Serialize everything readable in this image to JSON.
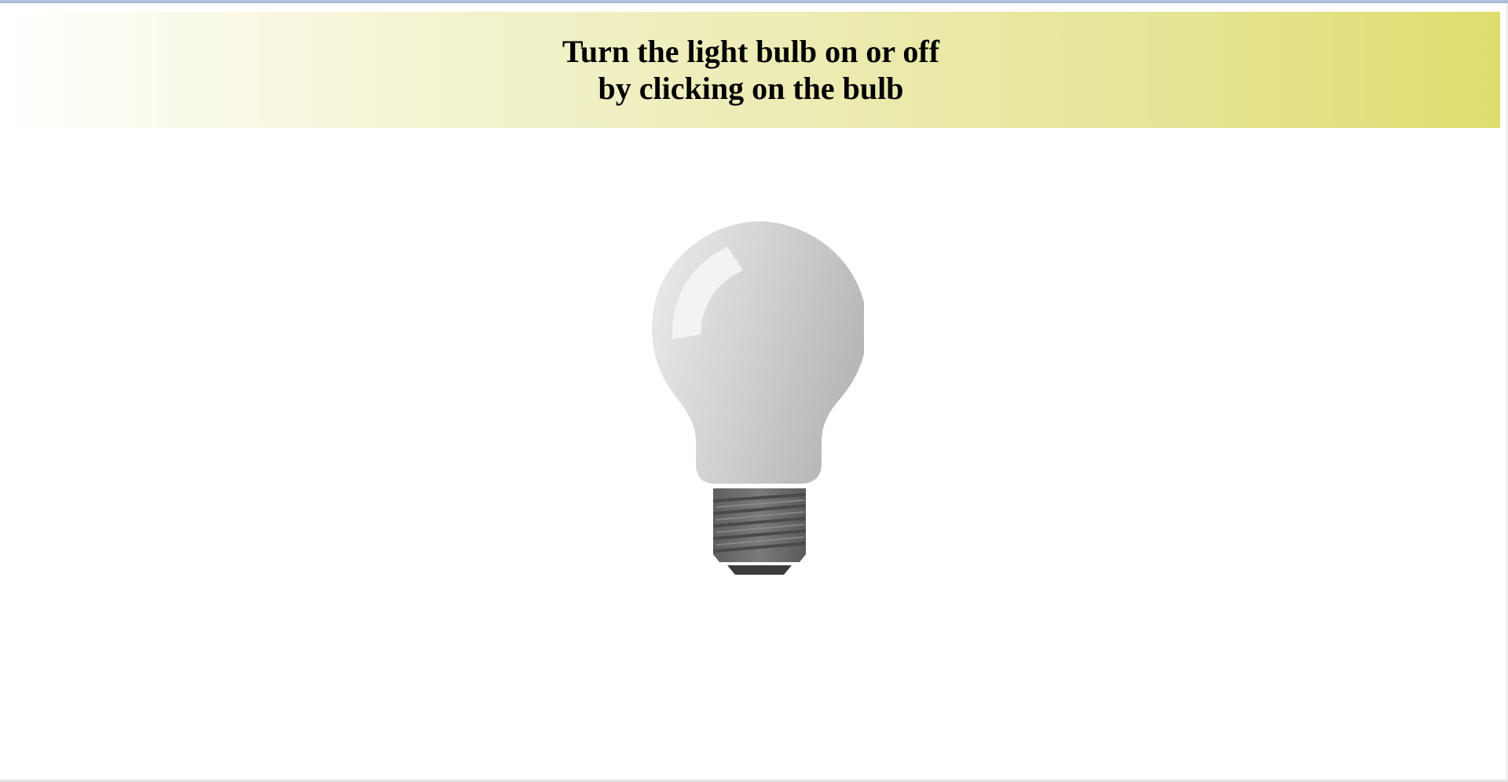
{
  "header": {
    "line1": "Turn the light bulb on or off",
    "line2": "by clicking on the bulb"
  },
  "bulb": {
    "state": "off",
    "glass_color": "#d8d8d8",
    "base_color": "#6e6e6e",
    "banner_accent": "#dfdd6e"
  }
}
